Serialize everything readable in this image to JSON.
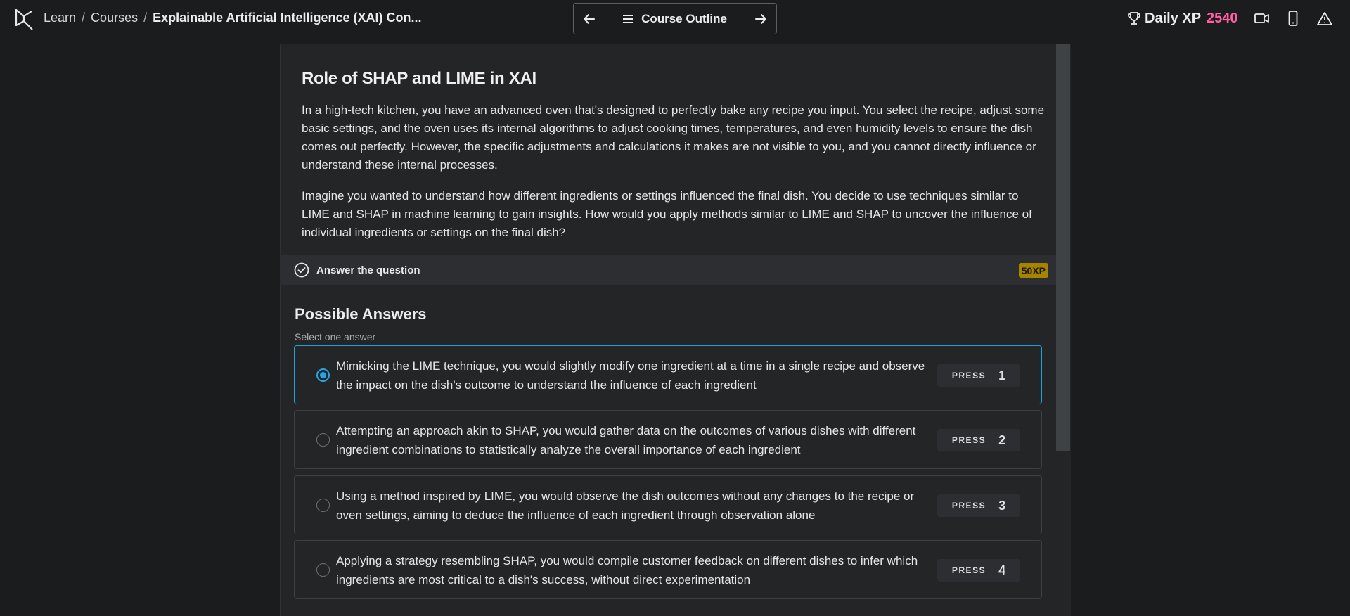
{
  "breadcrumb": {
    "items": [
      "Learn",
      "Courses"
    ],
    "current": "Explainable Artificial Intelligence (XAI) Con..."
  },
  "nav": {
    "outline_label": "Course Outline"
  },
  "header": {
    "xp_label": "Daily XP",
    "xp_value": "2540"
  },
  "exercise": {
    "title": "Role of SHAP and LIME in XAI",
    "paragraph1": "In a high-tech kitchen, you have an advanced oven that's designed to perfectly bake any recipe you input. You select the recipe, adjust some basic settings, and the oven uses its internal algorithms to adjust cooking times, temperatures, and even humidity levels to ensure the dish comes out perfectly. However, the specific adjustments and calculations it makes are not visible to you, and you cannot directly influence or understand these internal processes.",
    "paragraph2": "Imagine you wanted to understand how different ingredients or settings influenced the final dish. You decide to use techniques similar to LIME and SHAP in machine learning to gain insights. How would you apply methods similar to LIME and SHAP to uncover the influence of individual ingredients or settings on the final dish?"
  },
  "answer_bar": {
    "label": "Answer the question",
    "xp_badge": "50XP"
  },
  "answers": {
    "title": "Possible Answers",
    "hint": "Select one answer",
    "press_label": "PRESS",
    "options": [
      {
        "text": "Mimicking the LIME technique, you would slightly modify one ingredient at a time in a single recipe and observe the impact on the dish's outcome to understand the influence of each ingredient",
        "key": "1",
        "selected": true
      },
      {
        "text": "Attempting an approach akin to SHAP, you would gather data on the outcomes of various dishes with different ingredient combinations to statistically analyze the overall importance of each ingredient",
        "key": "2",
        "selected": false
      },
      {
        "text": "Using a method inspired by LIME, you would observe the dish outcomes without any changes to the recipe or oven settings, aiming to deduce the influence of each ingredient through observation alone",
        "key": "3",
        "selected": false
      },
      {
        "text": "Applying a strategy resembling SHAP, you would compile customer feedback on different dishes to infer which ingredients are most critical to a dish's success, without direct experimentation",
        "key": "4",
        "selected": false
      }
    ]
  },
  "colors": {
    "accent": "#22a6e6",
    "xp_value": "#ff5fa2",
    "xp_badge": "#a68400",
    "background": "#1b1c1e",
    "panel": "#242527"
  },
  "icons": {
    "logo": "datacamp-logo-icon",
    "prev": "arrow-left-icon",
    "next": "arrow-right-icon",
    "outline": "menu-lines-icon",
    "trophy": "trophy-icon",
    "video": "video-camera-icon",
    "mobile": "mobile-phone-icon",
    "report": "warning-triangle-icon",
    "check": "check-circle-icon"
  }
}
